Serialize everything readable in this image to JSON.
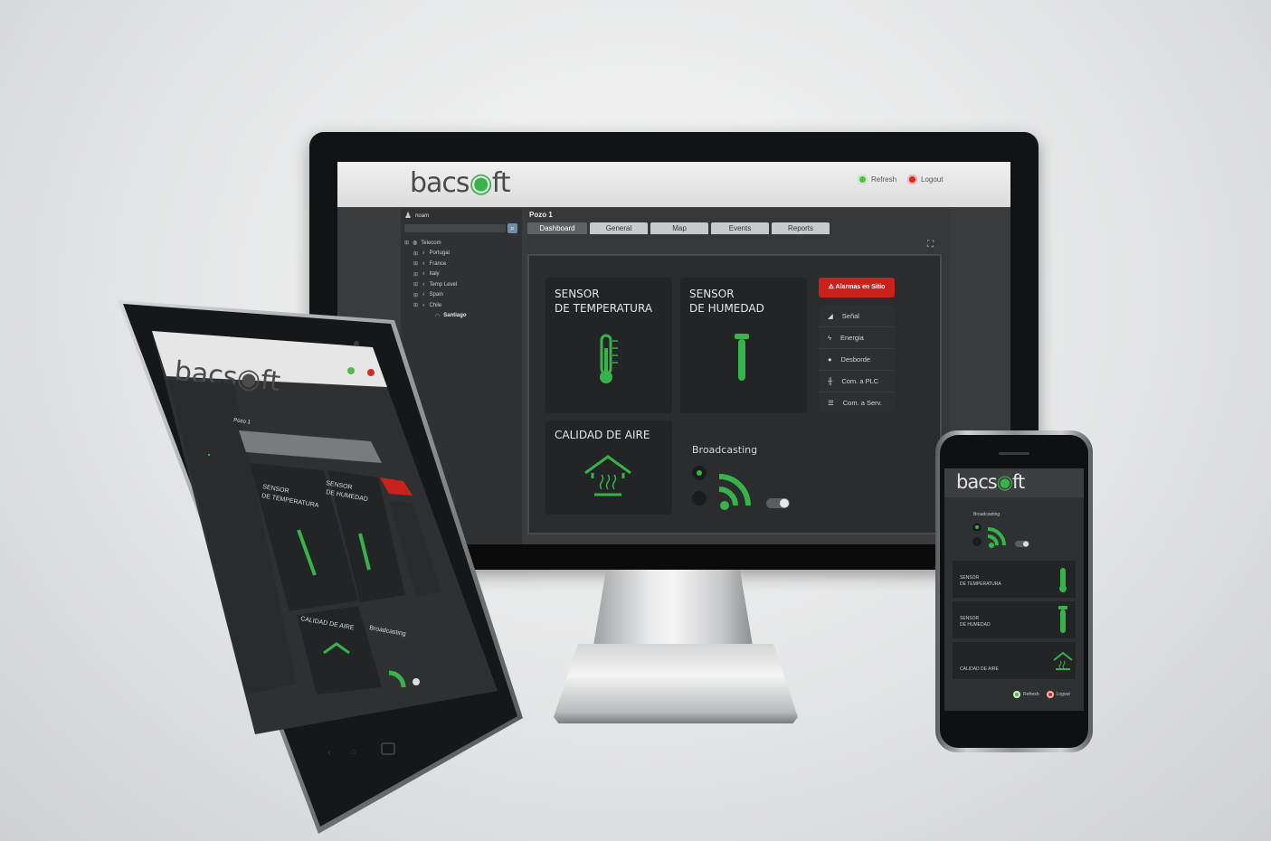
{
  "brand": {
    "logo": "bacsoft",
    "accent": "#38b34a",
    "alarm_color": "#c9221c"
  },
  "desktop": {
    "header": {
      "refresh_label": "Refresh",
      "logout_label": "Logout"
    },
    "user": {
      "name": "noam"
    },
    "tree": [
      {
        "label": "Telecom",
        "icon": "globe-icon"
      },
      {
        "label": "Portugal",
        "icon": "pin-icon"
      },
      {
        "label": "France",
        "icon": "pin-icon"
      },
      {
        "label": "Italy",
        "icon": "pin-icon"
      },
      {
        "label": "Temp Level",
        "icon": "pin-icon"
      },
      {
        "label": "Spain",
        "icon": "pin-icon"
      },
      {
        "label": "Chile",
        "icon": "pin-icon"
      },
      {
        "label": "Santiago",
        "icon": "broadcast-icon"
      }
    ],
    "page_title": "Pozo 1",
    "tabs": [
      "Dashboard",
      "General",
      "Map",
      "Events",
      "Reports"
    ],
    "active_tab": "Dashboard",
    "cards": {
      "temperature": {
        "line1": "SENSOR",
        "line2": "DE TEMPERATURA"
      },
      "humidity": {
        "line1": "SENSOR",
        "line2": "DE HUMEDAD"
      },
      "air": {
        "line1": "CALIDAD DE AIRE"
      }
    },
    "alarm_button": "Alarmas en Sitio",
    "alarms": [
      {
        "label": "Señal",
        "icon": "signal-icon"
      },
      {
        "label": "Energia",
        "icon": "bolt-icon"
      },
      {
        "label": "Desborde",
        "icon": "drop-icon"
      },
      {
        "label": "Com. a PLC",
        "icon": "sliders-icon"
      },
      {
        "label": "Com. a Serv.",
        "icon": "list-icon"
      }
    ],
    "broadcasting_label": "Broadcasting"
  },
  "phone": {
    "broadcasting_label": "Broadcasting",
    "rows": [
      {
        "line1": "SENSOR",
        "line2": "DE TEMPERATURA"
      },
      {
        "line1": "SENSOR",
        "line2": "DE HUMEDAD"
      },
      {
        "line1": "CALIDAD DE AIRE",
        "line2": ""
      }
    ],
    "refresh_label": "Refresh",
    "logout_label": "Logout"
  },
  "tablet": {
    "page_title": "Pozo 1",
    "card_temperature": {
      "line1": "SENSOR",
      "line2": "DE TEMPERATURA"
    },
    "card_humidity": {
      "line1": "SENSOR",
      "line2": "DE HUMEDAD"
    },
    "card_air": "CALIDAD DE AIRE",
    "broadcasting_label": "Broadcasting"
  }
}
